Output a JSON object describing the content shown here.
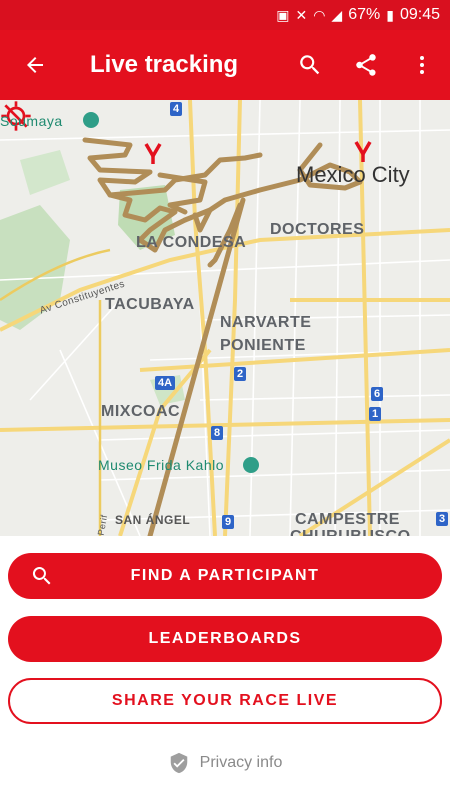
{
  "status_bar": {
    "battery": "67%",
    "time": "09:45"
  },
  "app_bar": {
    "title": "Live tracking"
  },
  "map": {
    "labels": {
      "soumaya": "Soumaya",
      "mexico_city": "Mexico City",
      "la_condesa": "LA CONDESA",
      "doctores": "DOCTORES",
      "tacubaya": "TACUBAYA",
      "av_constituyentes": "Av Constituyentes",
      "narvarte_1": "NARVARTE",
      "narvarte_2": "PONIENTE",
      "mixcoac": "MIXCOAC",
      "museo": "Museo Frida Kahlo",
      "san_angel": "SAN ÁNGEL",
      "campestre": "CAMPESTRE",
      "churubusco": "CHURUBUSCO",
      "periferico": "Perif"
    },
    "route_shields": [
      "4",
      "4A",
      "2",
      "8",
      "9",
      "6",
      "1",
      "3"
    ],
    "route_color": "#b08d57"
  },
  "buttons": {
    "find": "FIND A PARTICIPANT",
    "leaderboards": "LEADERBOARDS",
    "share": "SHARE YOUR RACE LIVE"
  },
  "privacy": "Privacy info",
  "colors": {
    "brand": "#e3101e"
  }
}
